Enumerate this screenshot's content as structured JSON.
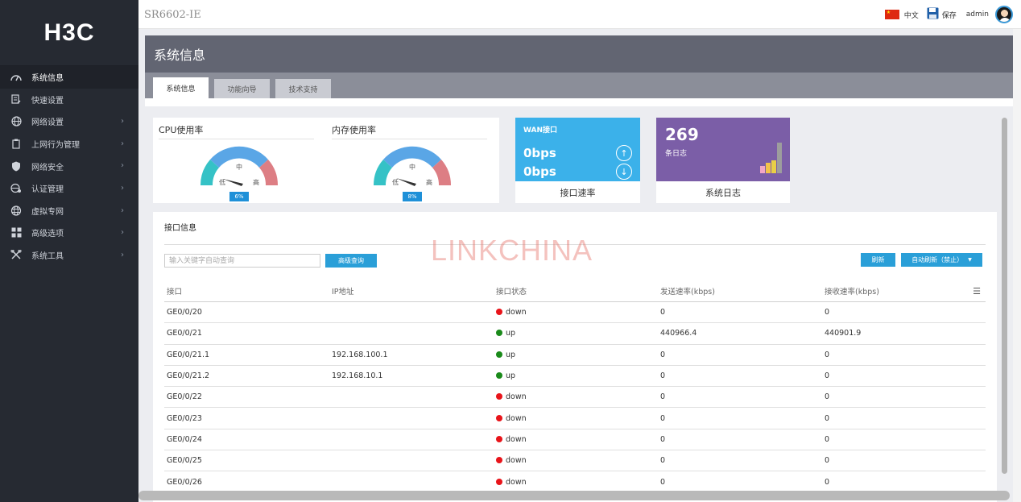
{
  "brand": {
    "logo": "H3C"
  },
  "sidebar": {
    "items": [
      {
        "label": "系统信息",
        "icon": "gauge-icon",
        "active": true
      },
      {
        "label": "快速设置",
        "icon": "edit-doc-icon"
      },
      {
        "label": "网络设置",
        "icon": "globe-icon"
      },
      {
        "label": "上网行为管理",
        "icon": "clipboard-icon"
      },
      {
        "label": "网络安全",
        "icon": "shield-icon"
      },
      {
        "label": "认证管理",
        "icon": "globe-key-icon"
      },
      {
        "label": "虚拟专网",
        "icon": "network-globe-icon"
      },
      {
        "label": "高级选项",
        "icon": "grid-icon"
      },
      {
        "label": "系统工具",
        "icon": "tools-icon"
      }
    ]
  },
  "topbar": {
    "model": "SR6602-IE",
    "language": "中文",
    "save": "保存",
    "user": "admin"
  },
  "page": {
    "title": "系统信息",
    "tabs": [
      "系统信息",
      "功能向导",
      "技术支持"
    ]
  },
  "cpu": {
    "label": "CPU使用率",
    "mid": "中",
    "low": "低",
    "high": "高",
    "value": "6%"
  },
  "mem": {
    "label": "内存使用率",
    "mid": "中",
    "low": "低",
    "high": "高",
    "value": "8%"
  },
  "wan": {
    "title": "WAN接口",
    "up": "0bps",
    "down": "0bps",
    "footer": "接口速率"
  },
  "syslog": {
    "count": "269",
    "unit": "条日志",
    "footer": "系统日志"
  },
  "interfaces": {
    "title": "接口信息",
    "search_placeholder": "输入关键字自动查询",
    "adv_search": "高级查询",
    "refresh": "刷新",
    "auto_refresh": "自动刷新（禁止）",
    "headers": [
      "接口",
      "IP地址",
      "接口状态",
      "发送速率(kbps)",
      "接收速率(kbps)"
    ],
    "rows": [
      {
        "name": "GE0/0/20",
        "ip": "",
        "status": "down",
        "tx": "0",
        "rx": "0"
      },
      {
        "name": "GE0/0/21",
        "ip": "",
        "status": "up",
        "tx": "440966.4",
        "rx": "440901.9"
      },
      {
        "name": "GE0/0/21.1",
        "ip": "192.168.100.1",
        "status": "up",
        "tx": "0",
        "rx": "0"
      },
      {
        "name": "GE0/0/21.2",
        "ip": "192.168.10.1",
        "status": "up",
        "tx": "0",
        "rx": "0"
      },
      {
        "name": "GE0/0/22",
        "ip": "",
        "status": "down",
        "tx": "0",
        "rx": "0"
      },
      {
        "name": "GE0/0/23",
        "ip": "",
        "status": "down",
        "tx": "0",
        "rx": "0"
      },
      {
        "name": "GE0/0/24",
        "ip": "",
        "status": "down",
        "tx": "0",
        "rx": "0"
      },
      {
        "name": "GE0/0/25",
        "ip": "",
        "status": "down",
        "tx": "0",
        "rx": "0"
      },
      {
        "name": "GE0/0/26",
        "ip": "",
        "status": "down",
        "tx": "0",
        "rx": "0"
      }
    ]
  },
  "colors": {
    "up": "#1a8a1a",
    "down": "#e8141a",
    "accent": "#2a9fd8"
  },
  "watermark": "LINKCHINA"
}
